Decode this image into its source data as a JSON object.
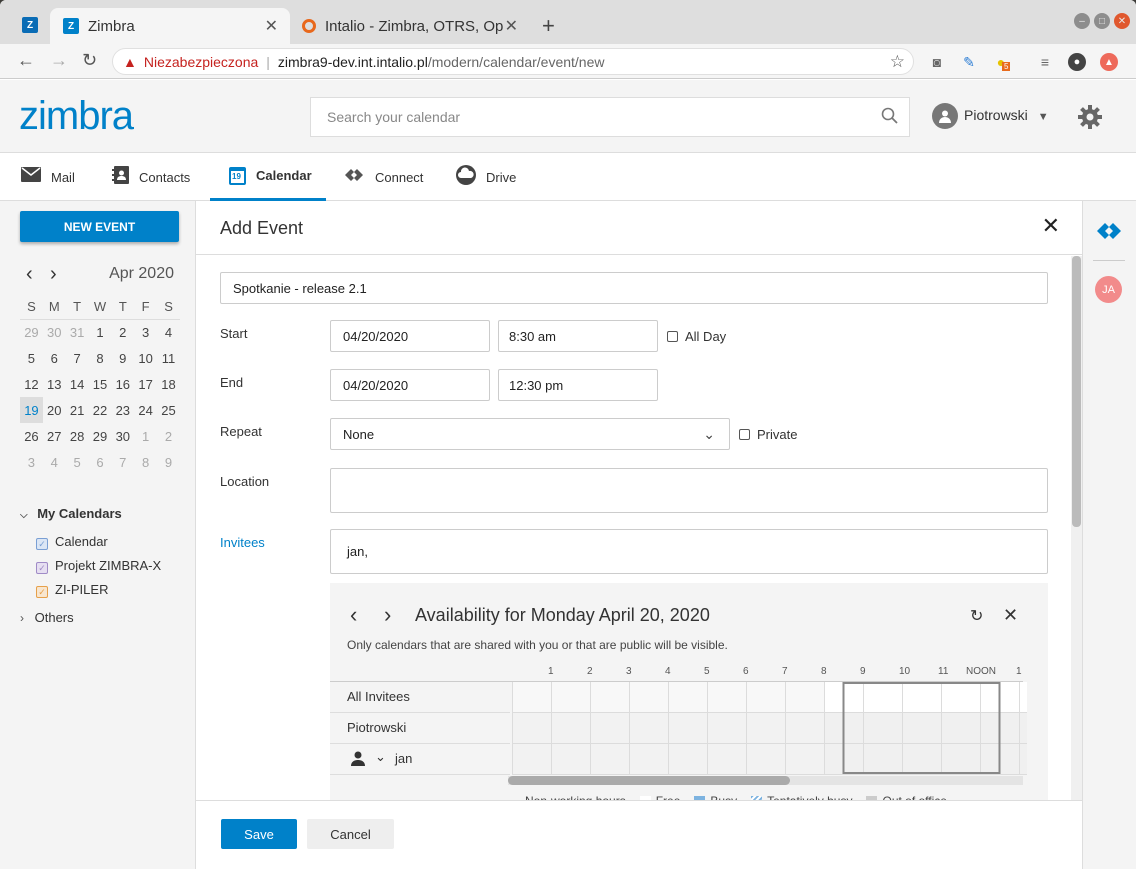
{
  "browser": {
    "tabs": [
      {
        "title": "Zimbra",
        "active": true
      },
      {
        "title": "Intalio - Zimbra, OTRS, Op",
        "active": false
      }
    ],
    "new_tab_symbol": "+",
    "security_label": "Niezabezpieczona",
    "url_host": "zimbra9-dev.int.intalio.pl",
    "url_path": "/modern/calendar/event/new",
    "ext_badge": "5"
  },
  "header": {
    "logo": "zimbra",
    "search_placeholder": "Search your calendar",
    "user_name": "Piotrowski"
  },
  "app_tabs": [
    {
      "label": "Mail",
      "icon": "mail-icon"
    },
    {
      "label": "Contacts",
      "icon": "contacts-icon"
    },
    {
      "label": "Calendar",
      "icon": "calendar-icon",
      "icon_text": "19",
      "active": true
    },
    {
      "label": "Connect",
      "icon": "connect-icon"
    },
    {
      "label": "Drive",
      "icon": "drive-icon"
    }
  ],
  "sidebar": {
    "new_event_label": "NEW EVENT",
    "month_label": "Apr 2020",
    "weekdays": [
      "S",
      "M",
      "T",
      "W",
      "T",
      "F",
      "S"
    ],
    "weeks": [
      [
        "29",
        "30",
        "31",
        "1",
        "2",
        "3",
        "4"
      ],
      [
        "5",
        "6",
        "7",
        "8",
        "9",
        "10",
        "11"
      ],
      [
        "12",
        "13",
        "14",
        "15",
        "16",
        "17",
        "18"
      ],
      [
        "19",
        "20",
        "21",
        "22",
        "23",
        "24",
        "25"
      ],
      [
        "26",
        "27",
        "28",
        "29",
        "30",
        "1",
        "2"
      ],
      [
        "3",
        "4",
        "5",
        "6",
        "7",
        "8",
        "9"
      ]
    ],
    "today": "19",
    "my_calendars_label": "My Calendars",
    "calendars": [
      {
        "name": "Calendar",
        "color": "#7a9fd4"
      },
      {
        "name": "Projekt ZIMBRA-X",
        "color": "#a08bc7"
      },
      {
        "name": "ZI-PILER",
        "color": "#e6a04a"
      }
    ],
    "others_label": "Others"
  },
  "event": {
    "panel_title": "Add Event",
    "subject": "Spotkanie - release 2.1",
    "start_label": "Start",
    "start_date": "04/20/2020",
    "start_time": "8:30 am",
    "all_day_label": "All Day",
    "end_label": "End",
    "end_date": "04/20/2020",
    "end_time": "12:30 pm",
    "repeat_label": "Repeat",
    "repeat_value": "None",
    "private_label": "Private",
    "location_label": "Location",
    "location_value": "",
    "invitees_label": "Invitees",
    "invitees_value": "jan,"
  },
  "availability": {
    "title": "Availability for Monday April 20, 2020",
    "note": "Only calendars that are shared with you or that are public will be visible.",
    "hours": [
      "1",
      "2",
      "3",
      "4",
      "5",
      "6",
      "7",
      "8",
      "9",
      "10",
      "11",
      "NOON",
      "1"
    ],
    "rows": [
      "All Invitees",
      "Piotrowski",
      "jan"
    ],
    "legend": [
      "Non-working hours",
      "Free",
      "Busy",
      "Tentatively busy",
      "Out of office"
    ]
  },
  "footer": {
    "save_label": "Save",
    "cancel_label": "Cancel"
  },
  "rail": {
    "avatar_initials": "JA"
  },
  "colors": {
    "accent": "#0081c9",
    "avatar_bg": "#f28b8b"
  }
}
